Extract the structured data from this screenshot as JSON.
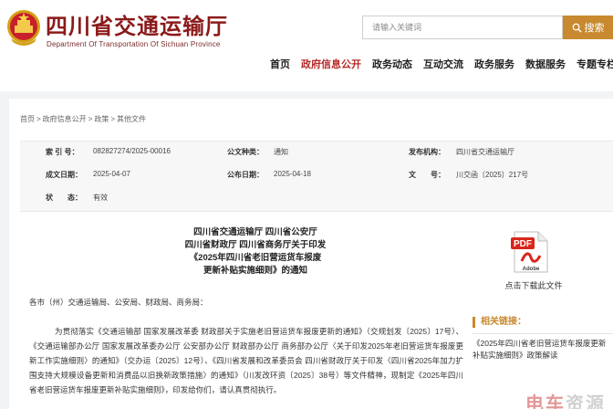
{
  "header": {
    "title": "四川省交通运输厅",
    "subtitle": "Department Of Transportation Of Sichuan Province",
    "search_placeholder": "请输入关键词",
    "search_button": "搜索"
  },
  "nav": {
    "items": [
      {
        "label": "首页",
        "active": false
      },
      {
        "label": "政府信息公开",
        "active": true
      },
      {
        "label": "政务动态",
        "active": false
      },
      {
        "label": "互动交流",
        "active": false
      },
      {
        "label": "政务服务",
        "active": false
      },
      {
        "label": "数据服务",
        "active": false
      },
      {
        "label": "专题专栏",
        "active": false
      }
    ]
  },
  "breadcrumb": [
    "首页",
    "政府信息公开",
    "政策",
    "其他文件"
  ],
  "breadcrumb_separator": ">",
  "meta": {
    "index_label": "索 引 号：",
    "index_value": "082827274/2025-00016",
    "pub_type_label": "公文种类：",
    "pub_type_value": "通知",
    "issuer_label": "发布机构：",
    "issuer_value": "四川省交通运输厅",
    "written_label": "成文日期：",
    "written_value": "2025-04-07",
    "pub_date_label": "公布日期：",
    "pub_date_value": "2025-04-18",
    "doc_no_label": "文　　号：",
    "doc_no_value": "川交函〔2025〕217号",
    "status_label": "状　　态：",
    "status_value": "有效"
  },
  "document": {
    "title_lines": [
      "四川省交通运输厅 四川省公安厅",
      "四川省财政厅 四川省商务厅关于印发",
      "《2025年四川省老旧营运货车报废",
      "更新补贴实施细则》的通知"
    ],
    "recipients": "各市（州）交通运输局、公安局、财政局、商务局：",
    "paragraph": "为贯彻落实《交通运输部 国家发展改革委 财政部关于实施老旧营运货车报废更新的通知》（交规划发〔2025〕17号）、《交通运输部办公厅 国家发展改革委办公厅 公安部办公厅 财政部办公厅 商务部办公厅〈关于印发2025年老旧营运货车报废更新工作实施细则〉的通知》（交办运〔2025〕12号）、《四川省发展和改革委员会 四川省财政厅关于印发〈四川省2025年加力扩围支持大规模设备更新和消费品以旧换新政策措施〉的通知》（川发改环资〔2025〕38号）等文件精神，现制定《2025年四川省老旧营运货车报废更新补贴实施细则》，印发给你们，请认真贯彻执行。"
  },
  "download": {
    "icon_text": "PDF",
    "brand_text": "Adobe",
    "caption": "点击下载此文件"
  },
  "related": {
    "title": "相关链接：",
    "link": "《2025年四川省老旧营运货车报废更新补贴实施细则》政策解读"
  },
  "watermark": {
    "part1": "电车",
    "part2": "资源"
  },
  "colors": {
    "brand_red": "#8b1a1a",
    "accent_gold": "#c8892f",
    "nav_active": "#b52a2a"
  }
}
